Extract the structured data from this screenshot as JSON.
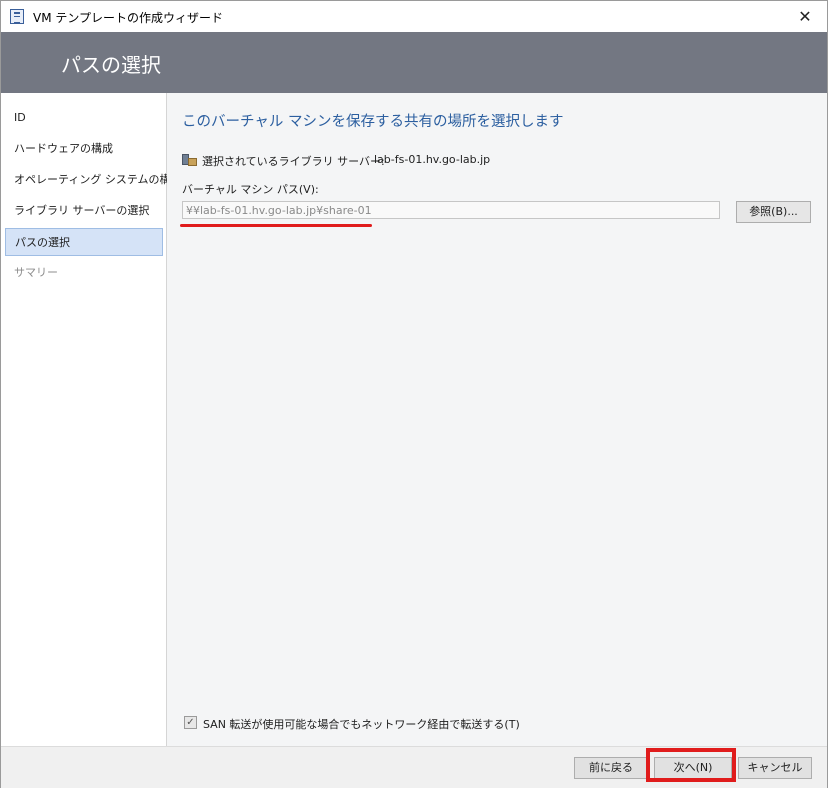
{
  "window": {
    "title": "VM テンプレートの作成ウィザード",
    "close_glyph": "✕"
  },
  "header": {
    "title": "パスの選択"
  },
  "sidebar": {
    "items": [
      {
        "label": "ID"
      },
      {
        "label": "ハードウェアの構成"
      },
      {
        "label": "オペレーティング システムの構成"
      },
      {
        "label": "ライブラリ サーバーの選択"
      },
      {
        "label": "パスの選択",
        "active": true
      },
      {
        "label": "サマリー",
        "disabled": true
      }
    ]
  },
  "main": {
    "heading": "このバーチャル マシンを保存する共有の場所を選択します",
    "library_server_label": "選択されているライブラリ サーバー:",
    "library_server_value": "lab-fs-01.hv.go-lab.jp",
    "path_label": "バーチャル マシン パス(V):",
    "path_value": "¥¥lab-fs-01.hv.go-lab.jp¥share-01",
    "browse_label": "参照(B)...",
    "san_checkbox_label": "SAN 転送が使用可能な場合でもネットワーク経由で転送する(T)",
    "san_checkbox_checked": true
  },
  "footer": {
    "back_label": "前に戻る",
    "next_label": "次へ(N)",
    "cancel_label": "キャンセル"
  },
  "colors": {
    "header_bg": "#737782",
    "heading_text": "#2c5fa0",
    "active_item_bg": "#d5e3f7",
    "annotation_red": "#e01c1c"
  }
}
